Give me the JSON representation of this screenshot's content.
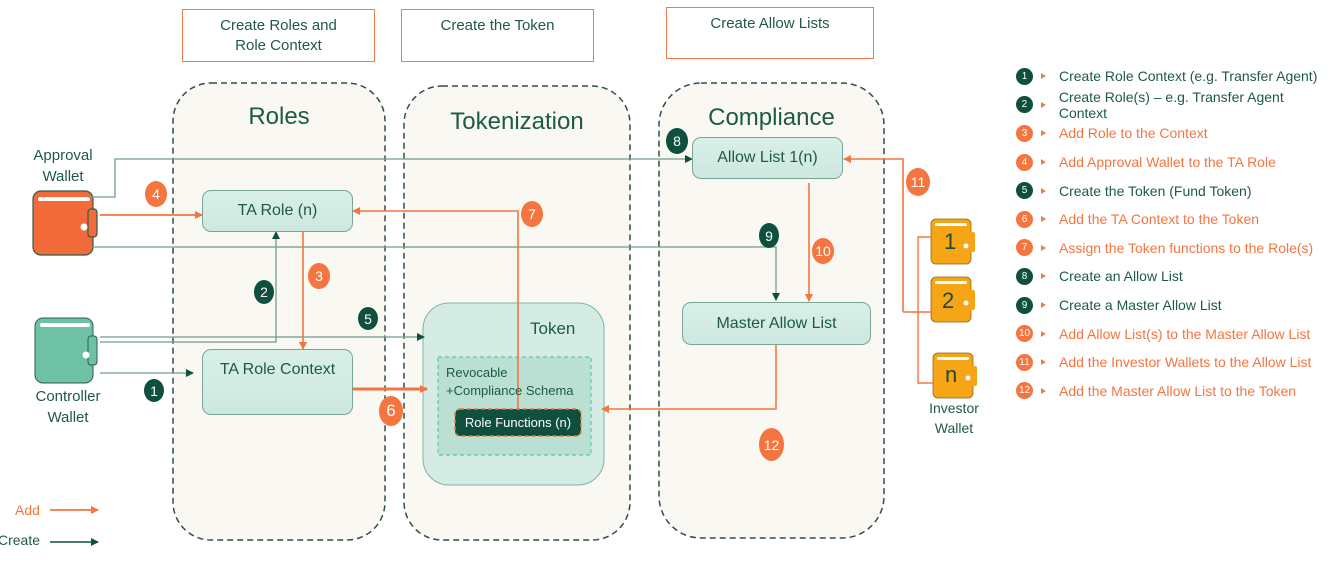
{
  "phases": [
    {
      "label": "Create Roles and Role Context"
    },
    {
      "label": "Create the Token"
    },
    {
      "label": "Create Allow Lists"
    }
  ],
  "zones": {
    "roles": "Roles",
    "tokenization": "Tokenization",
    "compliance": "Compliance"
  },
  "nodes": {
    "ta_role": "TA Role (n)",
    "ta_role_context": "TA Role Context",
    "token": "Token",
    "schema_line1": "Revocable",
    "schema_line2": "+Compliance Schema",
    "role_functions": "Role Functions (n)",
    "allow_list": "Allow List 1(n)",
    "master_allow_list": "Master Allow List"
  },
  "wallets": {
    "approval_line1": "Approval",
    "approval_line2": "Wallet",
    "controller_line1": "Controller",
    "controller_line2": "Wallet",
    "investor_line1": "Investor",
    "investor_line2": "Wallet",
    "investor_items": [
      "1",
      "2",
      "n"
    ]
  },
  "badges": [
    "1",
    "2",
    "3",
    "4",
    "5",
    "6",
    "7",
    "8",
    "9",
    "10",
    "11",
    "12"
  ],
  "key": {
    "add": "Add",
    "create": "Create"
  },
  "steps": [
    {
      "num": "1",
      "kind": "create",
      "text": "Create Role Context (e.g. Transfer Agent)"
    },
    {
      "num": "2",
      "kind": "create",
      "text": "Create Role(s) – e.g. Transfer Agent Context"
    },
    {
      "num": "3",
      "kind": "add",
      "text": "Add Role to the Context"
    },
    {
      "num": "4",
      "kind": "add",
      "text": "Add Approval Wallet to the TA Role"
    },
    {
      "num": "5",
      "kind": "create",
      "text": "Create the Token (Fund Token)"
    },
    {
      "num": "6",
      "kind": "add",
      "text": "Add the TA Context to the Token"
    },
    {
      "num": "7",
      "kind": "add",
      "text": "Assign the Token functions to the Role(s)"
    },
    {
      "num": "8",
      "kind": "create",
      "text": "Create an Allow List"
    },
    {
      "num": "9",
      "kind": "create",
      "text": "Create a Master Allow List"
    },
    {
      "num": "10",
      "kind": "add",
      "text": "Add Allow List(s) to the Master Allow List"
    },
    {
      "num": "11",
      "kind": "add",
      "text": "Add the Investor Wallets to the Allow List"
    },
    {
      "num": "12",
      "kind": "add",
      "text": "Add the Master Allow List to the Token"
    }
  ],
  "colors": {
    "create": "#0f4f3d",
    "add": "#f47540",
    "approval_wallet": "#f36b3b",
    "controller_wallet": "#6fc1a5",
    "investor_wallet": "#f5a515"
  }
}
